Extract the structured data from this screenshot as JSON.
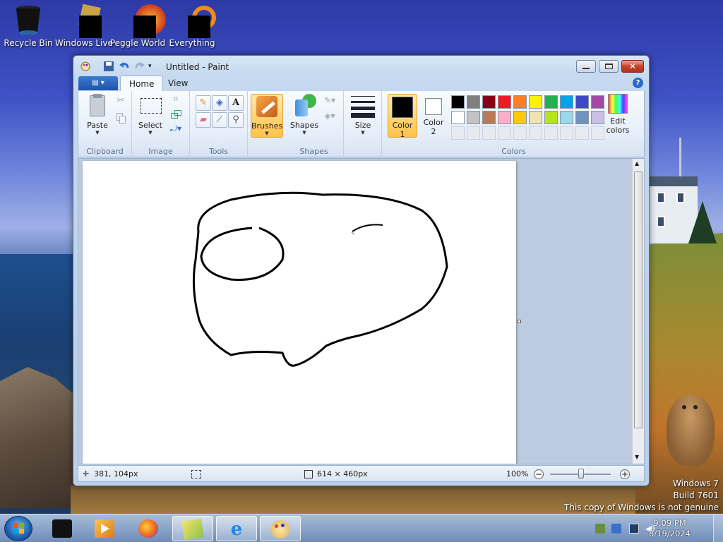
{
  "desktop": {
    "icons": [
      {
        "label": "Recycle Bin",
        "icon": "recycle-bin-icon"
      },
      {
        "label": "Windows Live",
        "icon": "windows-live-icon"
      },
      {
        "label": "Peggle World",
        "icon": "peggle-icon"
      },
      {
        "label": "Everything",
        "icon": "everything-search-icon"
      }
    ],
    "genuine": {
      "line1": "Windows 7",
      "line2": "Build 7601",
      "line3": "This copy of Windows is not genuine"
    }
  },
  "window": {
    "title": "Untitled - Paint",
    "tabs": [
      "Home",
      "View"
    ],
    "active_tab": "Home",
    "help_label": "?",
    "groups": {
      "clipboard": {
        "label": "Clipboard",
        "paste": "Paste"
      },
      "image": {
        "label": "Image",
        "select": "Select"
      },
      "tools": {
        "label": "Tools",
        "text_tool": "A"
      },
      "brushes": {
        "label": "Brushes"
      },
      "shapes": {
        "label": "Shapes",
        "shapes_btn": "Shapes"
      },
      "size": {
        "label": "Size"
      },
      "colors": {
        "label": "Colors",
        "color1_line1": "Color",
        "color1_line2": "1",
        "color2_line1": "Color",
        "color2_line2": "2",
        "edit_line1": "Edit",
        "edit_line2": "colors",
        "color1_value": "#000000",
        "color2_value": "#ffffff",
        "palette_row1": [
          "#000000",
          "#7f7f7f",
          "#880015",
          "#ed1c24",
          "#ff7f27",
          "#fff200",
          "#22b14c",
          "#00a2e8",
          "#3f48cc",
          "#a349a4"
        ],
        "palette_row2": [
          "#ffffff",
          "#c3c3c3",
          "#b97a57",
          "#ffaec9",
          "#ffc90e",
          "#efe4b0",
          "#b5e61d",
          "#99d9ea",
          "#7092be",
          "#c8bfe7"
        ]
      }
    },
    "statusbar": {
      "cursor_pos": "381, 104px",
      "selection_size": "",
      "canvas_size": "614 × 460px",
      "zoom": "100%",
      "zoom_minus": "−",
      "zoom_plus": "+"
    }
  },
  "taskbar": {
    "time": "9:09 PM",
    "date": "8/19/2024",
    "items": [
      "media-center-icon",
      "media-player-icon",
      "firefox-icon",
      "windows-live-folder-icon",
      "internet-explorer-icon",
      "paint-icon"
    ]
  }
}
